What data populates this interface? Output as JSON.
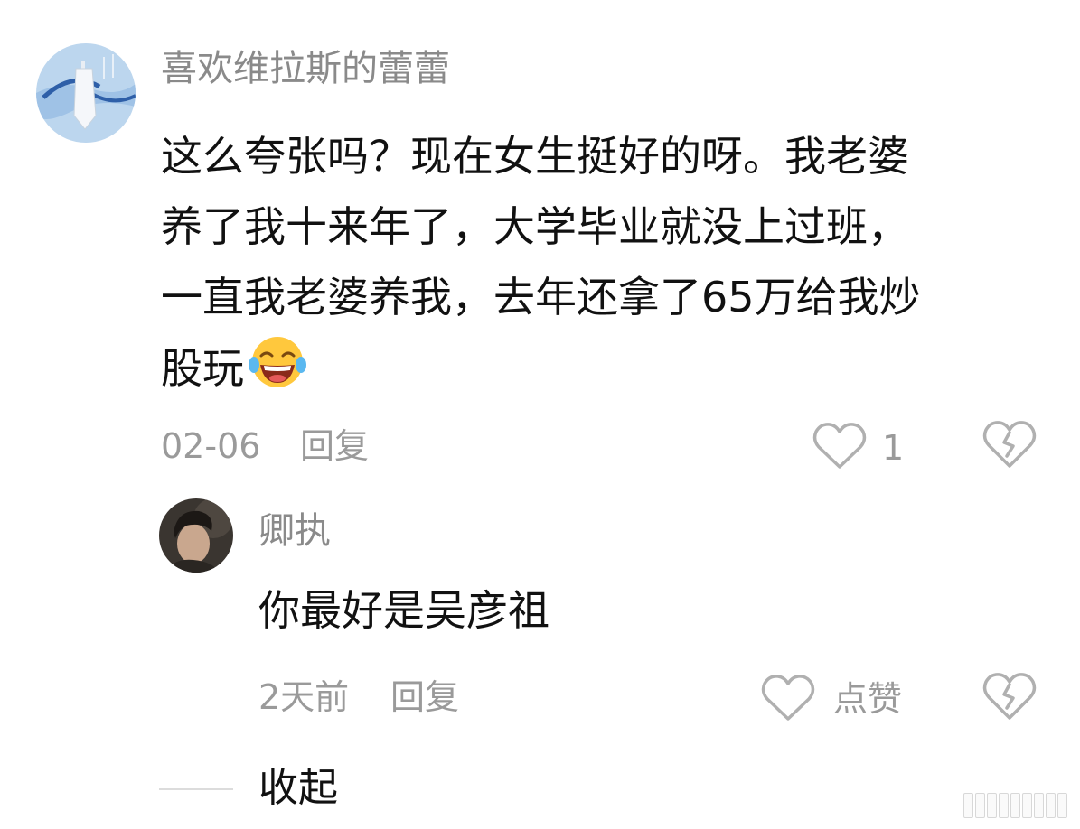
{
  "main_comment": {
    "username": "喜欢维拉斯的蕾蕾",
    "text_lines": [
      "这么夸张吗？现在女生挺好的呀。我老婆",
      "养了我十来年了，大学毕业就没上过班，",
      "一直我老婆养我，去年还拿了65万给我炒",
      "股玩"
    ],
    "emoji": "laughing-tears-emoji",
    "date": "02-06",
    "reply_label": "回复",
    "like_count": "1"
  },
  "reply_comment": {
    "username": "卿执",
    "text": "你最好是吴彦祖",
    "date": "2天前",
    "reply_label": "回复",
    "like_label": "点赞"
  },
  "collapse": {
    "label": "收起"
  },
  "icons": {
    "like": "heart-outline-icon",
    "dislike": "broken-heart-icon"
  },
  "colors": {
    "username": "#8a8a8a",
    "meta": "#9a9a9a",
    "body": "#111111",
    "icon_stroke": "#b0b0b0"
  }
}
